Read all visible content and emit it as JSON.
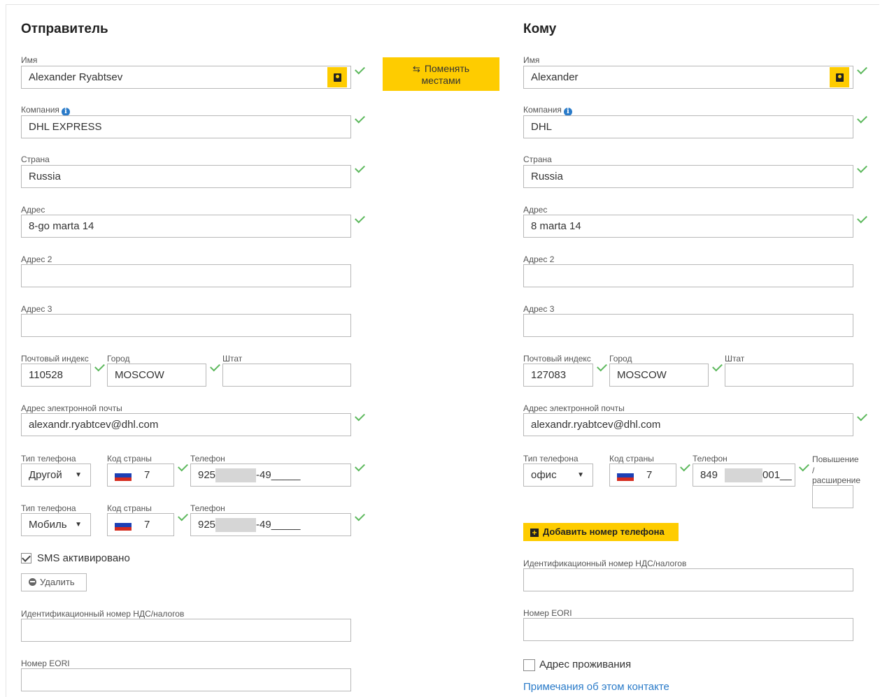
{
  "sender": {
    "title": "Отправитель",
    "name_label": "Имя",
    "name_value": "Alexander Ryabtsev",
    "company_label": "Компания",
    "company_value": "DHL EXPRESS",
    "country_label": "Страна",
    "country_value": "Russia",
    "address_label": "Адрес",
    "address_value": "8-go marta 14",
    "address2_label": "Адрес 2",
    "address2_value": "",
    "address3_label": "Адрес 3",
    "address3_value": "",
    "zip_label": "Почтовый индекс",
    "zip_value": "110528",
    "city_label": "Город",
    "city_value": "MOSCOW",
    "state_label": "Штат",
    "state_value": "",
    "email_label": "Адрес электронной почты",
    "email_value": "alexandr.ryabtcev@dhl.com",
    "phones": [
      {
        "type_label": "Тип телефона",
        "type_value": "Другой",
        "code_label": "Код страны",
        "code_value": "7",
        "phone_label": "Телефон",
        "phone_prefix": "925",
        "phone_suffix": "-49_____"
      },
      {
        "type_label": "Тип телефона",
        "type_value": "Мобиль",
        "code_label": "Код страны",
        "code_value": "7",
        "phone_label": "Телефон",
        "phone_prefix": "925",
        "phone_suffix": "-49_____"
      }
    ],
    "sms_label": "SMS активировано",
    "sms_checked": true,
    "delete_label": "Удалить",
    "vat_label": "Идентификационный номер НДС/налогов",
    "vat_value": "",
    "eori_label": "Номер EORI",
    "eori_value": ""
  },
  "swap_button": {
    "line1": "Поменять",
    "line2": "местами"
  },
  "recipient": {
    "title": "Кому",
    "name_label": "Имя",
    "name_value": "Alexander",
    "company_label": "Компания",
    "company_value": "DHL",
    "country_label": "Страна",
    "country_value": "Russia",
    "address_label": "Адрес",
    "address_value": "8 marta 14",
    "address2_label": "Адрес 2",
    "address2_value": "",
    "address3_label": "Адрес 3",
    "address3_value": "",
    "zip_label": "Почтовый индекс",
    "zip_value": "127083",
    "city_label": "Город",
    "city_value": "MOSCOW",
    "state_label": "Штат",
    "state_value": "",
    "email_label": "Адрес электронной почты",
    "email_value": "alexandr.ryabtcev@dhl.com",
    "phone": {
      "type_label": "Тип телефона",
      "type_value": "офис",
      "code_label": "Код страны",
      "code_value": "7",
      "phone_label": "Телефон",
      "phone_prefix": "849",
      "phone_suffix": "001__",
      "ext_label_1": "Повышение",
      "ext_label_2": "/",
      "ext_label_3": "расширение",
      "ext_value": ""
    },
    "add_phone_label": "Добавить номер телефона",
    "vat_label": "Идентификационный номер НДС/налогов",
    "vat_value": "",
    "eori_label": "Номер EORI",
    "eori_value": "",
    "residential_label": "Адрес проживания",
    "residential_checked": false,
    "notes_link": "Примечания об этом контакте"
  },
  "colors": {
    "accent": "#fecc00",
    "check": "#5cb85c",
    "link": "#2a7bc9",
    "flag_white": "#ffffff",
    "flag_blue": "#1c3fb5",
    "flag_red": "#d52b1e"
  },
  "icons": [
    "contact-book-icon",
    "info-icon",
    "swap-icon",
    "check-icon",
    "chevron-down-icon",
    "russia-flag-icon",
    "minus-circle-icon",
    "plus-square-icon"
  ]
}
